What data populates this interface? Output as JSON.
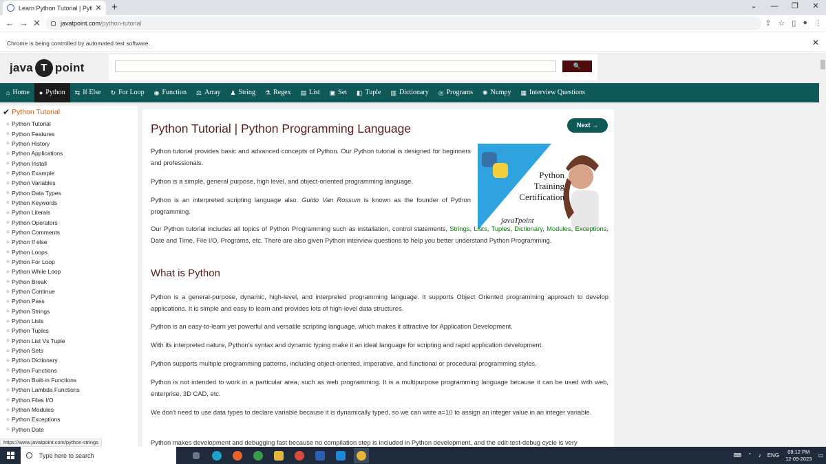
{
  "browser": {
    "tab_title": "Learn Python Tutorial | Python P",
    "tab_close": "✕",
    "new_tab": "+",
    "url_host": "javatpoint.com",
    "url_path": "/python-tutorial",
    "infobar_text": "Chrome is being controlled by automated test software.",
    "infobar_close": "✕",
    "status_url": "https://www.javatpoint.com/python-strings"
  },
  "site": {
    "logo_left": "java",
    "logo_mid": "T",
    "logo_right": "point",
    "search_placeholder": "",
    "search_button": "🔍"
  },
  "menu": [
    {
      "icon": "⌂",
      "label": "Home"
    },
    {
      "icon": "●",
      "label": "Python"
    },
    {
      "icon": "⇆",
      "label": "If Else"
    },
    {
      "icon": "↻",
      "label": "For Loop"
    },
    {
      "icon": "◉",
      "label": "Function"
    },
    {
      "icon": "⚖",
      "label": "Array"
    },
    {
      "icon": "♟",
      "label": "String"
    },
    {
      "icon": "⚗",
      "label": "Regex"
    },
    {
      "icon": "▤",
      "label": "List"
    },
    {
      "icon": "▣",
      "label": "Set"
    },
    {
      "icon": "◧",
      "label": "Tuple"
    },
    {
      "icon": "▥",
      "label": "Dictionary"
    },
    {
      "icon": "◎",
      "label": "Programs"
    },
    {
      "icon": "✺",
      "label": "Numpy"
    },
    {
      "icon": "▦",
      "label": "Interview Questions"
    }
  ],
  "sidebar": {
    "heading": "Python Tutorial",
    "items": [
      "Python Tutorial",
      "Python Features",
      "Python History",
      "Python Applications",
      "Python Install",
      "Python Example",
      "Python Variables",
      "Python Data Types",
      "Python Keywords",
      "Python Literals",
      "Python Operators",
      "Python Comments",
      "Python If else",
      "Python Loops",
      "Python For Loop",
      "Python While Loop",
      "Python Break",
      "Python Continue",
      "Python Pass",
      "Python Strings",
      "Python Lists",
      "Python Tuples",
      "Python List Vs Tuple",
      "Python Sets",
      "Python Dictionary",
      "Python Functions",
      "Python Built-in Functions",
      "Python Lambda Functions",
      "Python Files I/O",
      "Python Modules",
      "Python Exceptions",
      "Python Date"
    ]
  },
  "article": {
    "title": "Python Tutorial | Python Programming Language",
    "next_label": "Next →",
    "p1": "Python tutorial provides basic and advanced concepts of Python. Our Python tutorial is designed for beginners and professionals.",
    "p2": "Python is a simple, general purpose, high level, and object-oriented programming language.",
    "p3_a": "Python is an interpreted scripting language also. ",
    "p3_em": "Guido Van Rossum",
    "p3_b": " is known as the founder of Python programming.",
    "p4_a": "Our Python tutorial includes all topics of Python Programming such as installation, control statements, ",
    "links": [
      "Strings",
      "Lists",
      "Tuples",
      "Dictionary",
      "Modules",
      "Exceptions"
    ],
    "p4_b": " Date and Time, File I/O, Programs, etc. There are also given Python interview questions to help you better understand Python Programming.",
    "banner_line1": "Python",
    "banner_line2": "Training",
    "banner_line3": "Certification",
    "banner_brand": "javaTpoint",
    "h2": "What is Python",
    "q1": "Python is a general-purpose, dynamic, high-level, and interpreted programming language. It supports Object Oriented programming approach to develop applications. It is simple and easy to learn and provides lots of high-level data structures.",
    "q2": "Python is an easy-to-learn yet powerful and versatile scripting language, which makes it attractive for Application Development.",
    "q3": "With its interpreted nature, Python's syntax and dynamic typing make it an ideal language for scripting and rapid application development.",
    "q4": "Python supports multiple programming patterns, including object-oriented, imperative, and functional or procedural programming styles.",
    "q5": "Python is not intended to work in a particular area, such as web programming. It is a multipurpose programming language because it can be used with web, enterprise, 3D CAD, etc.",
    "q6": "We don't need to use data types to declare variable because it is dynamically typed, so we can write a=10 to assign an integer value in an integer variable.",
    "q7": "Python makes development and debugging fast because no compilation step is included in Python development, and the edit-test-debug cycle is very"
  },
  "taskbar": {
    "search_placeholder": "Type here to search",
    "lang": "ENG",
    "time": "08:12 PM",
    "date": "12-09-2023"
  },
  "colors": {
    "menubar": "#0f5958",
    "heading": "#5b1a1a",
    "link": "#0a7a0a",
    "sidebar_head": "#e05a06"
  }
}
